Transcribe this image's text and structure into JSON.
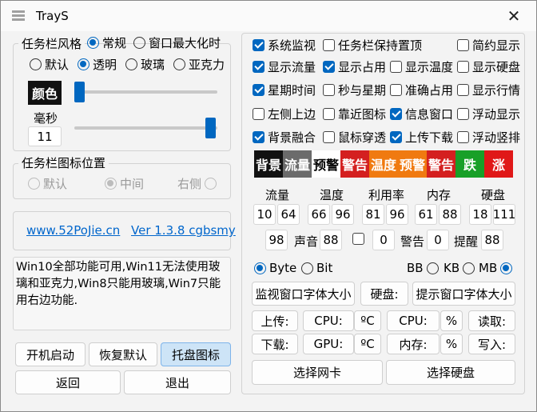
{
  "window": {
    "title": "TrayS",
    "close": "✕"
  },
  "style_group": {
    "title": "任务栏风格",
    "mode_normal": "常规",
    "mode_maximized": "窗口最大化时",
    "default": "默认",
    "transparent": "透明",
    "glass": "玻璃",
    "acrylic": "亚克力",
    "color_button": "颜色",
    "ms_label": "毫秒",
    "ms_value": "11",
    "color_slider_level": 0.0,
    "ms_slider_level": 1.0
  },
  "icon_pos_group": {
    "title": "任务栏图标位置",
    "default": "默认",
    "center": "中间",
    "right": "右侧"
  },
  "links": {
    "site": "www.52PoJie.cn",
    "version": "Ver 1.3.8 cgbsmy"
  },
  "info_text": "Win10全部功能可用,Win11无法使用玻璃和亚克力,Win8只能用玻璃,Win7只能用右边功能.",
  "left_buttons": {
    "autostart": "开机启动",
    "restore": "恢复默认",
    "tray_icon": "托盘图标",
    "back": "返回",
    "exit": "退出"
  },
  "options": {
    "row1": [
      "系统监视",
      "任务栏保持置顶",
      "简约显示"
    ],
    "row2": [
      "显示流量",
      "显示占用",
      "显示温度",
      "显示硬盘"
    ],
    "row3": [
      "星期时间",
      "秒与星期",
      "准确占用",
      "显示行情"
    ],
    "row4": [
      "左侧上边",
      "靠近图标",
      "信息窗口",
      "浮动显示"
    ],
    "row5": [
      "背景融合",
      "鼠标穿透",
      "上传下载",
      "浮动竖排"
    ]
  },
  "colors": {
    "accent": "#0067c0",
    "strip": [
      "#111111",
      "#6b6b6b",
      "#ffffff",
      "#d42020",
      "#f07a10",
      "#f07a10",
      "#d42020",
      "#18a028",
      "#e01818"
    ],
    "strip_labels": [
      "背景",
      "流量",
      "预警",
      "警告",
      "温度",
      "预警",
      "警告",
      "跌",
      "涨"
    ]
  },
  "thresholds": {
    "headers": [
      "流量",
      "温度",
      "利用率",
      "内存",
      "硬盘"
    ],
    "flow": [
      "10",
      "64"
    ],
    "temp": [
      "66",
      "96"
    ],
    "usage": [
      "81",
      "96"
    ],
    "mem": [
      "61",
      "88"
    ],
    "disk": [
      "18",
      "111"
    ],
    "row2": {
      "v1": "98",
      "sound": "声音",
      "v2": "88",
      "v3": "0",
      "warn": "警告",
      "v4": "0",
      "remind": "提醒",
      "v5": "88"
    }
  },
  "units": {
    "byte": "Byte",
    "bit": "Bit",
    "bb": "BB",
    "kb": "KB",
    "mb": "MB"
  },
  "font_buttons": {
    "monitor": "监视窗口字体大小",
    "disk": "硬盘:",
    "tip": "提示窗口字体大小"
  },
  "stats": {
    "upload": "上传:",
    "cpu": "CPU:",
    "cpu_unit": "ºC",
    "cpu2": "CPU:",
    "pct": "%",
    "read": "读取:",
    "download": "下载:",
    "gpu": "GPU:",
    "gpu_unit": "ºC",
    "mem": "内存:",
    "pct2": "%",
    "write": "写入:"
  },
  "select_buttons": {
    "nic": "选择网卡",
    "disk": "选择硬盘"
  }
}
